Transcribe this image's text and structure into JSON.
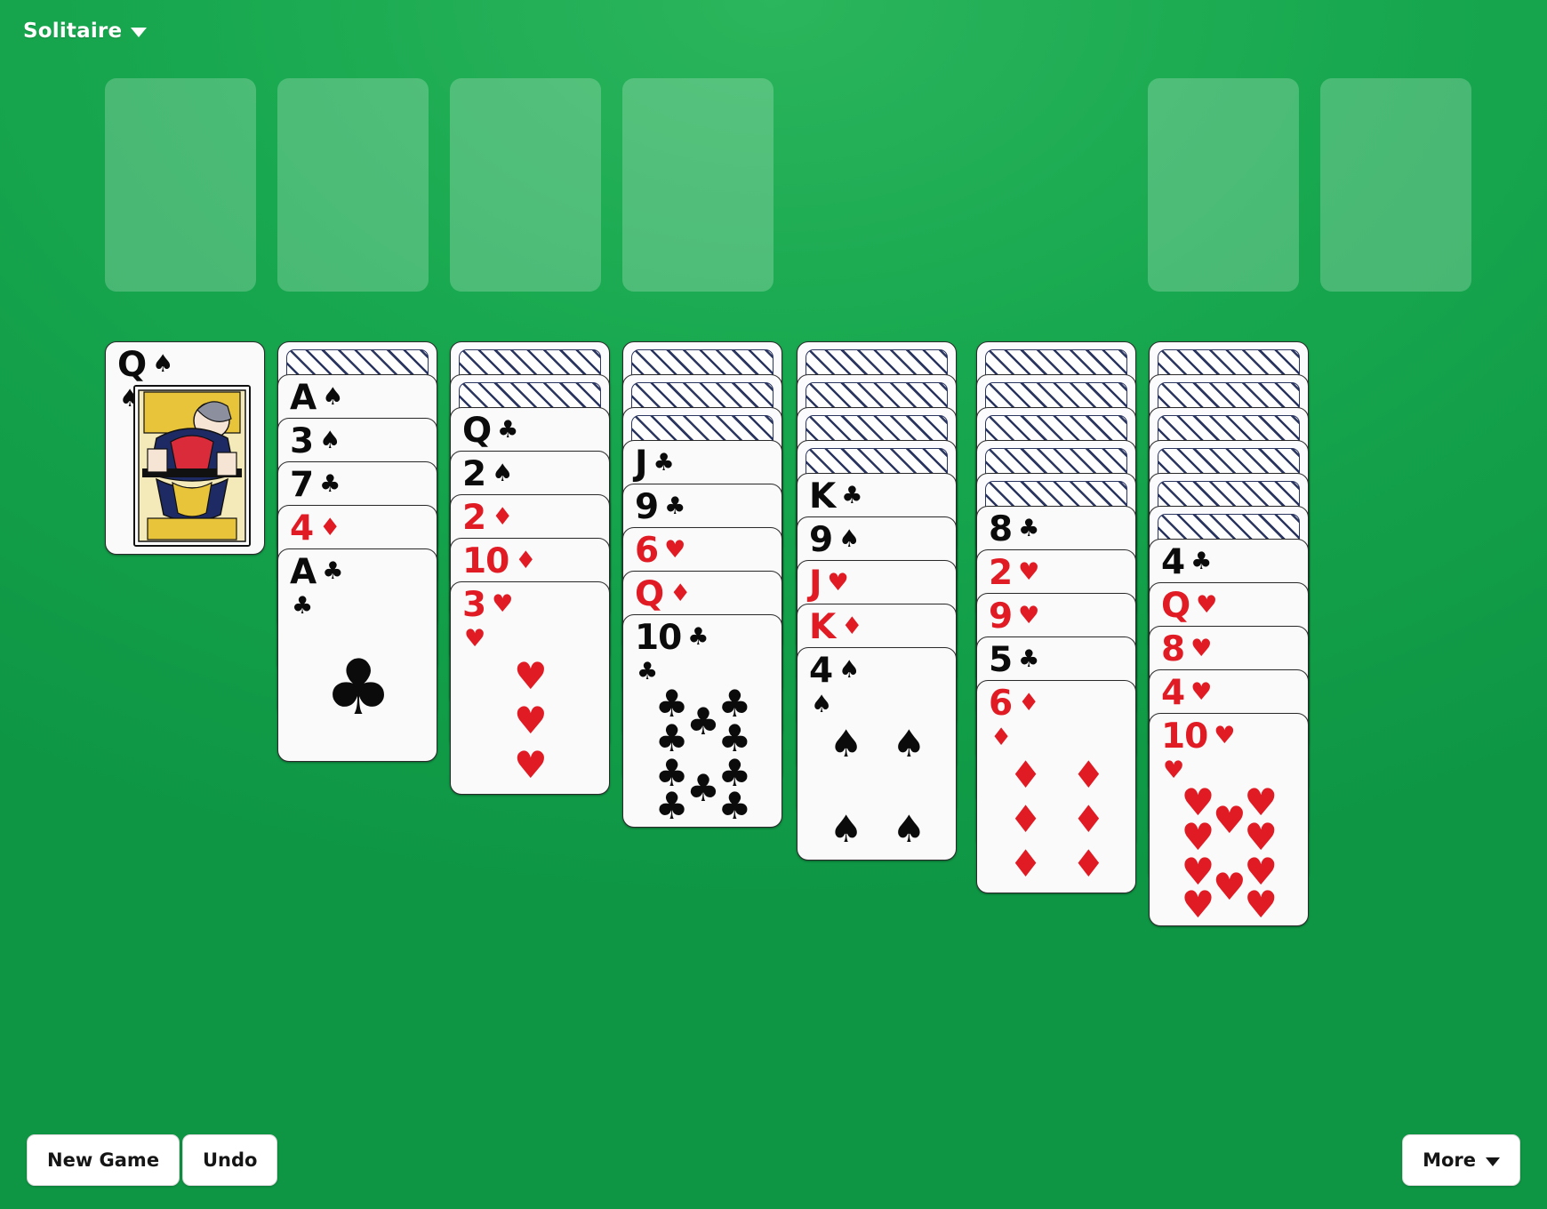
{
  "header": {
    "title": "Solitaire",
    "menu_icon": "chevron-down-icon"
  },
  "footer": {
    "new_game_label": "New Game",
    "undo_label": "Undo",
    "more_label": "More",
    "more_icon": "chevron-down-icon"
  },
  "table": {
    "felt_color": "#18a84f",
    "empty_slot_color": "rgba(255,255,255,0.22)",
    "red_suit_color": "#e01b24",
    "black_suit_color": "#0b0b0b"
  },
  "suits": {
    "spade": "♠",
    "heart": "♥",
    "diamond": "♦",
    "club": "♣"
  },
  "top_row": {
    "stock": {
      "name": "stock-pile",
      "state": "empty"
    },
    "waste": {
      "name": "waste-pile",
      "card": {
        "rank": "Q",
        "suit": "spade",
        "color": "black",
        "face": "up",
        "court": true
      }
    },
    "foundations": [
      {
        "name": "foundation-spades",
        "state": "empty"
      },
      {
        "name": "foundation-hearts",
        "state": "empty"
      },
      {
        "name": "foundation-diamonds",
        "state": "empty"
      },
      {
        "name": "foundation-clubs",
        "state": "empty"
      }
    ]
  },
  "tableau": {
    "columns": [
      {
        "index": 1,
        "face_down": 1,
        "face_up": [
          {
            "rank": "A",
            "suit": "spade",
            "color": "black"
          },
          {
            "rank": "3",
            "suit": "spade",
            "color": "black"
          },
          {
            "rank": "7",
            "suit": "club",
            "color": "black"
          },
          {
            "rank": "4",
            "suit": "diamond",
            "color": "red"
          },
          {
            "rank": "A",
            "suit": "club",
            "color": "black"
          }
        ]
      },
      {
        "index": 2,
        "face_down": 2,
        "face_up": [
          {
            "rank": "Q",
            "suit": "club",
            "color": "black"
          },
          {
            "rank": "2",
            "suit": "spade",
            "color": "black"
          },
          {
            "rank": "2",
            "suit": "diamond",
            "color": "red"
          },
          {
            "rank": "10",
            "suit": "diamond",
            "color": "red"
          },
          {
            "rank": "3",
            "suit": "heart",
            "color": "red"
          }
        ]
      },
      {
        "index": 3,
        "face_down": 3,
        "face_up": [
          {
            "rank": "J",
            "suit": "club",
            "color": "black"
          },
          {
            "rank": "9",
            "suit": "club",
            "color": "black"
          },
          {
            "rank": "6",
            "suit": "heart",
            "color": "red"
          },
          {
            "rank": "Q",
            "suit": "diamond",
            "color": "red"
          },
          {
            "rank": "10",
            "suit": "club",
            "color": "black"
          }
        ]
      },
      {
        "index": 4,
        "face_down": 4,
        "face_up": [
          {
            "rank": "K",
            "suit": "club",
            "color": "black"
          },
          {
            "rank": "9",
            "suit": "spade",
            "color": "black"
          },
          {
            "rank": "J",
            "suit": "heart",
            "color": "red"
          },
          {
            "rank": "K",
            "suit": "diamond",
            "color": "red"
          },
          {
            "rank": "4",
            "suit": "spade",
            "color": "black"
          }
        ]
      },
      {
        "index": 5,
        "face_down": 5,
        "face_up": [
          {
            "rank": "8",
            "suit": "club",
            "color": "black"
          },
          {
            "rank": "2",
            "suit": "heart",
            "color": "red"
          },
          {
            "rank": "9",
            "suit": "heart",
            "color": "red"
          },
          {
            "rank": "5",
            "suit": "club",
            "color": "black"
          },
          {
            "rank": "6",
            "suit": "diamond",
            "color": "red"
          }
        ]
      },
      {
        "index": 6,
        "face_down": 6,
        "face_up": [
          {
            "rank": "4",
            "suit": "club",
            "color": "black"
          },
          {
            "rank": "Q",
            "suit": "heart",
            "color": "red"
          },
          {
            "rank": "8",
            "suit": "heart",
            "color": "red"
          },
          {
            "rank": "4",
            "suit": "heart",
            "color": "red"
          },
          {
            "rank": "10",
            "suit": "heart",
            "color": "red"
          }
        ]
      }
    ]
  }
}
